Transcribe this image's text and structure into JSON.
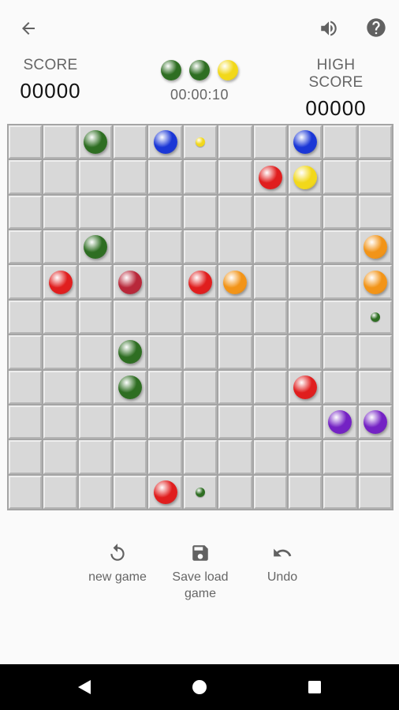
{
  "score": {
    "label": "SCORE",
    "value": "00000"
  },
  "high_score": {
    "label": "HIGH SCORE",
    "value": "00000"
  },
  "timer": "00:00:10",
  "next_balls": [
    "green",
    "green",
    "yellow"
  ],
  "colors": {
    "green": "#2e6e22",
    "blue": "#1b37d6",
    "yellow": "#f2d81a",
    "red": "#e01e1e",
    "crimson": "#b8283a",
    "orange": "#f29418",
    "purple": "#7422c4"
  },
  "board": {
    "size": 11,
    "pieces": [
      {
        "row": 0,
        "col": 2,
        "color": "green",
        "size": "big"
      },
      {
        "row": 0,
        "col": 4,
        "color": "blue",
        "size": "big"
      },
      {
        "row": 0,
        "col": 5,
        "color": "yellow",
        "size": "small"
      },
      {
        "row": 0,
        "col": 8,
        "color": "blue",
        "size": "big"
      },
      {
        "row": 1,
        "col": 7,
        "color": "red",
        "size": "big"
      },
      {
        "row": 1,
        "col": 8,
        "color": "yellow",
        "size": "big"
      },
      {
        "row": 3,
        "col": 2,
        "color": "green",
        "size": "big"
      },
      {
        "row": 3,
        "col": 10,
        "color": "orange",
        "size": "big"
      },
      {
        "row": 4,
        "col": 1,
        "color": "red",
        "size": "big"
      },
      {
        "row": 4,
        "col": 3,
        "color": "crimson",
        "size": "big"
      },
      {
        "row": 4,
        "col": 5,
        "color": "red",
        "size": "big"
      },
      {
        "row": 4,
        "col": 6,
        "color": "orange",
        "size": "big"
      },
      {
        "row": 4,
        "col": 10,
        "color": "orange",
        "size": "big"
      },
      {
        "row": 5,
        "col": 10,
        "color": "green",
        "size": "small"
      },
      {
        "row": 6,
        "col": 3,
        "color": "green",
        "size": "big"
      },
      {
        "row": 7,
        "col": 3,
        "color": "green",
        "size": "big"
      },
      {
        "row": 7,
        "col": 8,
        "color": "red",
        "size": "big"
      },
      {
        "row": 8,
        "col": 9,
        "color": "purple",
        "size": "big"
      },
      {
        "row": 8,
        "col": 10,
        "color": "purple",
        "size": "big"
      },
      {
        "row": 10,
        "col": 4,
        "color": "red",
        "size": "big"
      },
      {
        "row": 10,
        "col": 5,
        "color": "green",
        "size": "small"
      }
    ]
  },
  "actions": {
    "new_game": "new game",
    "save_load_line1": "Save load",
    "save_load_line2": "game",
    "undo": "Undo"
  },
  "icons": {
    "back": "arrow-back-icon",
    "volume": "volume-icon",
    "help": "help-icon",
    "new_game": "restart-icon",
    "save": "save-icon",
    "undo": "undo-icon"
  }
}
